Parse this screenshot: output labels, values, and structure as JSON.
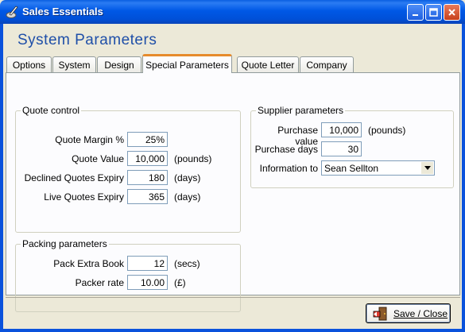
{
  "window": {
    "title": "Sales Essentials",
    "icons": {
      "app": "quill-icon",
      "minimize": "minimize-icon",
      "maximize": "maximize-icon",
      "close": "close-icon"
    }
  },
  "page": {
    "title": "System Parameters"
  },
  "tabs": [
    {
      "label": "Options",
      "active": false
    },
    {
      "label": "System",
      "active": false
    },
    {
      "label": "Design",
      "active": false
    },
    {
      "label": "Special Parameters",
      "active": true
    },
    {
      "label": "Quote Letter",
      "active": false
    },
    {
      "label": "Company",
      "active": false
    }
  ],
  "quote_control": {
    "title": "Quote control",
    "fields": [
      {
        "label": "Quote Margin %",
        "value": "25%",
        "unit": ""
      },
      {
        "label": "Quote Value",
        "value": "10,000",
        "unit": "(pounds)"
      },
      {
        "label": "Declined Quotes Expiry",
        "value": "180",
        "unit": "(days)"
      },
      {
        "label": "Live Quotes Expiry",
        "value": "365",
        "unit": "(days)"
      }
    ]
  },
  "packing": {
    "title": "Packing parameters",
    "fields": [
      {
        "label": "Pack Extra Book",
        "value": "12",
        "unit": "(secs)"
      },
      {
        "label": "Packer rate",
        "value": "10.00",
        "unit": "(£)"
      }
    ]
  },
  "supplier": {
    "title": "Supplier parameters",
    "purchase_value": {
      "label": "Purchase value",
      "value": "10,000",
      "unit": "(pounds)"
    },
    "purchase_days": {
      "label": "Purchase days",
      "value": "30"
    },
    "information_to": {
      "label": "Information to",
      "value": "Sean Sellton"
    }
  },
  "footer": {
    "save_label": "Save / Close"
  },
  "colors": {
    "title_bar": "#0058e6",
    "page_title": "#1f4fa8",
    "active_tab_accent": "#e68b2c",
    "background": "#ece9d8"
  }
}
